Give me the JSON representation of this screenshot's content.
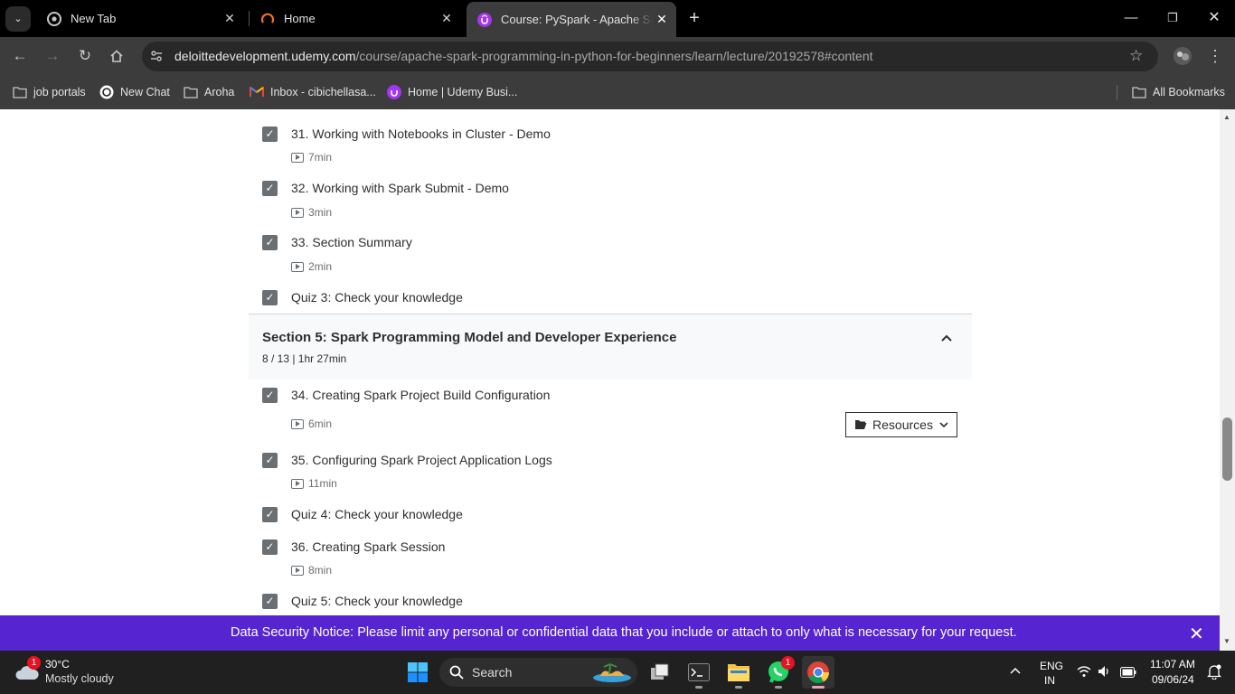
{
  "browser": {
    "tabs": [
      {
        "title": "New Tab",
        "favicon": "chrome-icon"
      },
      {
        "title": "Home",
        "favicon": "home-orange-icon"
      },
      {
        "title": "Course: PySpark - Apache Spark",
        "favicon": "udemy-icon",
        "active": true
      }
    ],
    "url_host": "deloittedevelopment.udemy.com",
    "url_path": "/course/apache-spark-programming-in-python-for-beginners/learn/lecture/20192578#content",
    "bookmarks": [
      {
        "label": "job portals",
        "icon": "folder-icon"
      },
      {
        "label": "New Chat",
        "icon": "chatgpt-icon"
      },
      {
        "label": "Aroha",
        "icon": "folder-icon"
      },
      {
        "label": "Inbox - cibichellasa...",
        "icon": "gmail-icon"
      },
      {
        "label": "Home | Udemy Busi...",
        "icon": "udemy-icon"
      }
    ],
    "all_bookmarks": "All Bookmarks"
  },
  "curriculum": {
    "items_before": [
      {
        "title": "31. Working with Notebooks in Cluster - Demo",
        "duration": "7min"
      },
      {
        "title": "32. Working with Spark Submit - Demo",
        "duration": "3min"
      },
      {
        "title": "33. Section Summary",
        "duration": "2min"
      },
      {
        "title": "Quiz 3: Check your knowledge"
      }
    ],
    "section": {
      "title": "Section 5: Spark Programming Model and Developer Experience",
      "meta": "8 / 13 | 1hr 27min"
    },
    "items_after": [
      {
        "title": "34. Creating Spark Project Build Configuration",
        "duration": "6min",
        "resources": "Resources"
      },
      {
        "title": "35. Configuring Spark Project Application Logs",
        "duration": "11min"
      },
      {
        "title": "Quiz 4: Check your knowledge"
      },
      {
        "title": "36. Creating Spark Session",
        "duration": "8min"
      },
      {
        "title": "Quiz 5: Check your knowledge"
      }
    ]
  },
  "notice": {
    "text": "Data Security Notice: Please limit any personal or confidential data that you include or attach to only what is necessary for your request."
  },
  "taskbar": {
    "weather_temp": "30°C",
    "weather_desc": "Mostly cloudy",
    "weather_badge": "1",
    "search_label": "Search",
    "whatsapp_badge": "1",
    "lang": "ENG",
    "region": "IN",
    "time": "11:07 AM",
    "date": "09/06/24"
  },
  "colors": {
    "udemy_purple": "#5624d0",
    "checkbox_grey": "#6a6f73"
  }
}
